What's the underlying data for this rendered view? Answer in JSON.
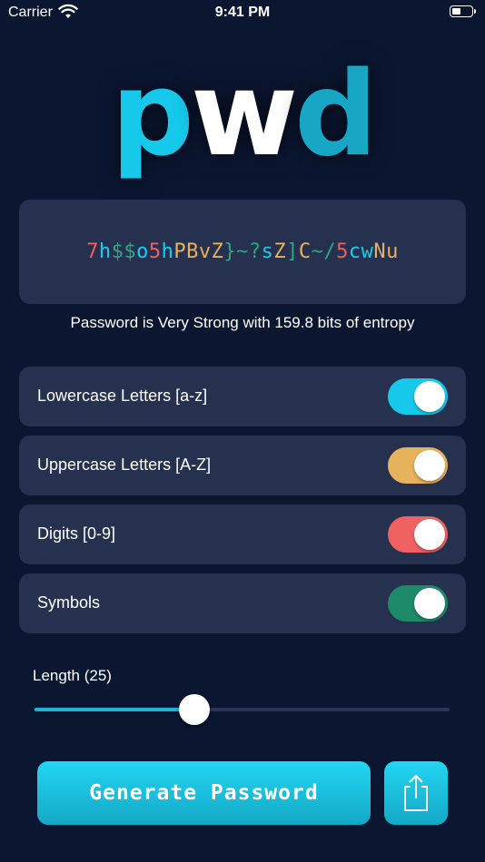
{
  "status_bar": {
    "carrier": "Carrier",
    "time": "9:41 PM"
  },
  "logo": {
    "parts": [
      {
        "text": "p",
        "color": "#16c9eb"
      },
      {
        "text": "w",
        "color": "#ffffff"
      },
      {
        "text": "d",
        "color": "#17a6c3"
      }
    ]
  },
  "password": {
    "segments": [
      {
        "text": "7",
        "color": "#f15f5f"
      },
      {
        "text": "h",
        "color": "#1bcdea"
      },
      {
        "text": "$$",
        "color": "#2ba882"
      },
      {
        "text": "o",
        "color": "#1bcdea"
      },
      {
        "text": "5",
        "color": "#f15f5f"
      },
      {
        "text": "h",
        "color": "#1bcdea"
      },
      {
        "text": "PBv",
        "color": "#e6b25e"
      },
      {
        "text": "Z",
        "color": "#e6b25e"
      },
      {
        "text": "}~?",
        "color": "#2ba882"
      },
      {
        "text": "s",
        "color": "#1bcdea"
      },
      {
        "text": "Z",
        "color": "#e6b25e"
      },
      {
        "text": "]",
        "color": "#2ba882"
      },
      {
        "text": "C",
        "color": "#e6b25e"
      },
      {
        "text": "~/",
        "color": "#2ba882"
      },
      {
        "text": "5",
        "color": "#f15f5f"
      },
      {
        "text": "cw",
        "color": "#1bcdea"
      },
      {
        "text": "Nu",
        "color": "#e6b25e"
      }
    ]
  },
  "strength_text": "Password is Very Strong with 159.8 bits of entropy",
  "options": [
    {
      "label": "Lowercase Letters [a-z]",
      "on": true,
      "color": "#16c9eb"
    },
    {
      "label": "Uppercase Letters [A-Z]",
      "on": true,
      "color": "#e6b25e"
    },
    {
      "label": "Digits [0-9]",
      "on": true,
      "color": "#f06262"
    },
    {
      "label": "Symbols",
      "on": true,
      "color": "#1f8a68"
    }
  ],
  "length": {
    "label": "Length (25)",
    "fraction": 0.385
  },
  "generate_label": "Generate Password",
  "share_icon": "share-icon"
}
